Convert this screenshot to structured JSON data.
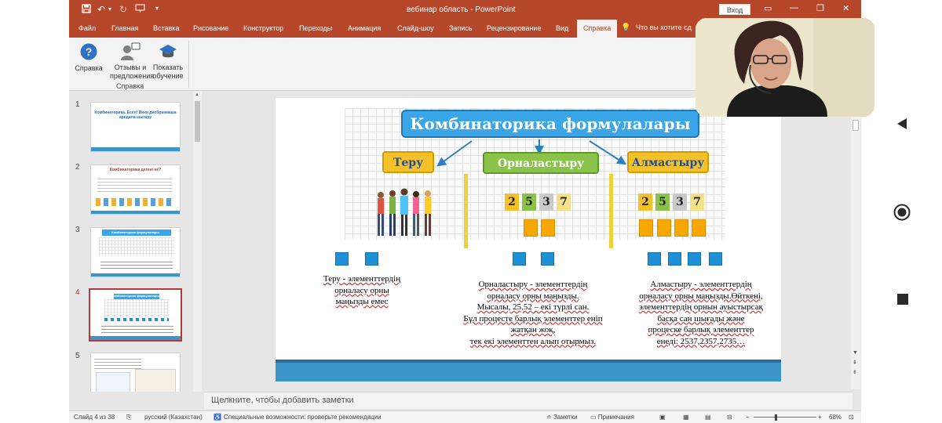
{
  "window": {
    "title": "вебинар область  -  PowerPoint",
    "login_label": "Вход"
  },
  "tabs": [
    "Файл",
    "Главная",
    "Вставка",
    "Рисование",
    "Конструктор",
    "Переходы",
    "Анимация",
    "Слайд-шоу",
    "Запись",
    "Рецензирование",
    "Вид",
    "Справка"
  ],
  "active_tab": "Справка",
  "tell_me": "Что вы хотите сд",
  "ribbon": {
    "help_label": "Справка",
    "feedback_label_1": "Отзывы и",
    "feedback_label_2": "предложения",
    "training_label_1": "Показать",
    "training_label_2": "обучение",
    "group_label": "Справка"
  },
  "thumbnails": {
    "items": [
      {
        "num": "1",
        "title": "Комбинаторика. Есеп! Вики дисбранмаша арндала шыгару"
      },
      {
        "num": "2",
        "title": "Комбинаторика дегенi не?"
      },
      {
        "num": "3",
        "title": "Комбинаторика формулалары"
      },
      {
        "num": "4",
        "title": "Комбинаторика формулалары"
      },
      {
        "num": "5",
        "title": ""
      }
    ],
    "active": "4"
  },
  "slide": {
    "banner": "Комбинаторика формулалары",
    "label_teru": "Теру",
    "label_ornalastyru": "Орналастыру",
    "label_almastyru": "Алмастыру",
    "digits": [
      "2",
      "5",
      "3",
      "7"
    ],
    "text_teru": [
      "Теру - элементтердің",
      "орналасу орны",
      "маңызды емес"
    ],
    "text_ornalastyru": [
      "Орналастыру - элементтердің",
      "орналасу орны маңызды.",
      "Мысалы, 25,52 – екі түрлі сан.",
      "Бұл процесте барлық элементтер еніп",
      "жатқан жоқ,",
      "тек екі элементтен алып отырмыз."
    ],
    "text_almastyru": [
      "Алмастыру - элементтердің",
      "орналасу орны маңызды.Өйткені,",
      "элементтердің орнын ауыстырсақ",
      "басқа сан шығады және",
      "процеске барлық элементтер",
      "енеді: 2537,2357,2735…"
    ]
  },
  "notes_placeholder": "Щелкните, чтобы добавить заметки",
  "status": {
    "slide_of": "Слайд 4 из 38",
    "language": "русский (Казахстан)",
    "accessibility": "Специальные возможности: проверьте рекомендации",
    "notes_btn": "Заметки",
    "comments_btn": "Примечания",
    "zoom": "68%"
  },
  "colors": {
    "ppt_accent": "#b7472a",
    "banner": "#3aa6e8",
    "orn_green": "#8bc34a",
    "label_yellow": "#f5c12b",
    "square_blue": "#1e90d6",
    "slide_bar": "#3c95c8"
  }
}
